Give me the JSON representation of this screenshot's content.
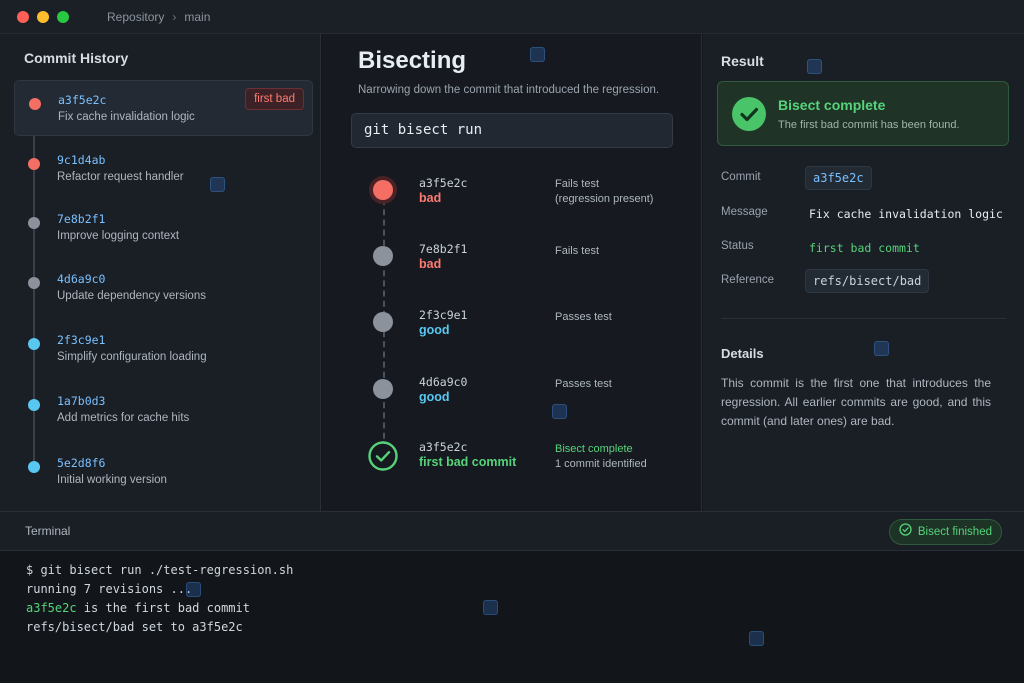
{
  "titlebar": {
    "window_dots": [
      "#ff5f57",
      "#febc2e",
      "#28c840"
    ],
    "repo_label": "Repository",
    "separator": "›",
    "branch": "main"
  },
  "history": {
    "title": "Commit History",
    "commits": [
      {
        "hash": "a3f5e2c",
        "message": "Fix cache invalidation logic",
        "color": "#f56e64",
        "badge": "first bad"
      },
      {
        "hash": "9c1d4ab",
        "message": "Refactor request handler",
        "color": "#f56e64"
      },
      {
        "hash": "7e8b2f1",
        "message": "Improve logging context",
        "color": "#8b929c"
      },
      {
        "hash": "4d6a9c0",
        "message": "Update dependency versions",
        "color": "#8b929c"
      },
      {
        "hash": "2f3c9e1",
        "message": "Simplify configuration loading",
        "color": "#58c8f0"
      },
      {
        "hash": "1a7b0d3",
        "message": "Add metrics for cache hits",
        "color": "#58c8f0"
      },
      {
        "hash": "5e2d8f6",
        "message": "Initial working version",
        "color": "#58c8f0"
      }
    ]
  },
  "bisect": {
    "title": "Bisecting",
    "subtitle": "Narrowing down the commit that introduced the regression.",
    "command": "git bisect run",
    "steps": [
      {
        "hash": "a3f5e2c",
        "status": "bad",
        "status_color": "#ff7b72",
        "note": "Fails test",
        "note2": "(regression present)"
      },
      {
        "hash": "7e8b2f1",
        "status": "bad",
        "status_color": "#ff7b72",
        "note": "Fails test",
        "note2": ""
      },
      {
        "hash": "2f3c9e1",
        "status": "good",
        "status_color": "#58c8f0",
        "note": "Passes test",
        "note2": ""
      },
      {
        "hash": "4d6a9c0",
        "status": "good",
        "status_color": "#58c8f0",
        "note": "Passes test",
        "note2": ""
      },
      {
        "hash": "a3f5e2c",
        "status": "first bad commit",
        "status_color": "#56d37a",
        "note": "Bisect complete",
        "note2": "1 commit identified"
      }
    ]
  },
  "result": {
    "title": "Result",
    "card_title": "Bisect complete",
    "card_subtitle": "The first bad commit has been found.",
    "commit_label": "Commit",
    "commit_value": "a3f5e2c",
    "message_label": "Message",
    "message_value": "Fix cache invalidation logic",
    "status_label": "Status",
    "status_value": "first bad commit",
    "reference_label": "Reference",
    "reference_value": "refs/bisect/bad",
    "details_title": "Details",
    "details_text": "This commit is the first one that introduces the regression. All earlier commits are good, and this commit (and later ones) are bad."
  },
  "terminal": {
    "title": "Terminal",
    "badge": "Bisect finished",
    "lines": [
      {
        "prefix": "",
        "text": "$ git bisect run ./test-regression.sh"
      },
      {
        "prefix": "",
        "text": "running 7 revisions ..."
      },
      {
        "prefix": "a3f5e2c",
        "text": " is the first bad commit"
      },
      {
        "prefix": "",
        "text": "refs/bisect/bad set to a3f5e2c"
      }
    ]
  },
  "colors": {
    "accent_green": "#56d37a",
    "bad_red": "#ff7b72",
    "good_blue": "#58c8f0",
    "hash_blue": "#79c0ff"
  }
}
